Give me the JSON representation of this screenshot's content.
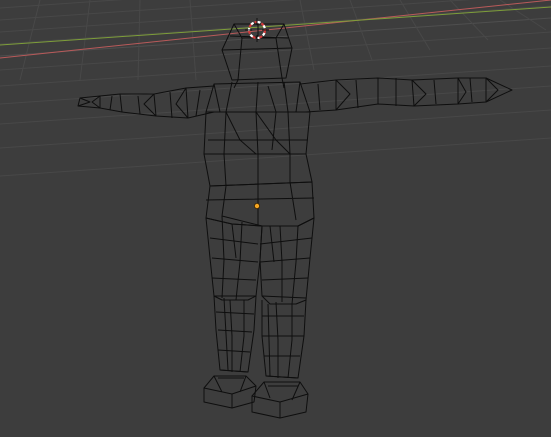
{
  "viewport": {
    "mode": "wireframe",
    "background_color": "#3d3d3d",
    "grid_color": "#484848",
    "x_axis_color": "#b95a5a",
    "y_axis_color": "#7e9e3a",
    "wire_color": "#0e0e0e",
    "origin_color": "#f5a623",
    "cursor_colors": [
      "#d43a3a",
      "#ffffff"
    ]
  },
  "scene": {
    "object": "humanoid-mesh",
    "pose": "T-pose",
    "parts": [
      "head",
      "torso",
      "pelvis",
      "left-arm",
      "right-arm",
      "left-leg",
      "right-leg",
      "left-foot",
      "right-foot"
    ]
  },
  "icons": {
    "cursor": "3d-cursor-icon",
    "origin": "object-origin-icon"
  }
}
